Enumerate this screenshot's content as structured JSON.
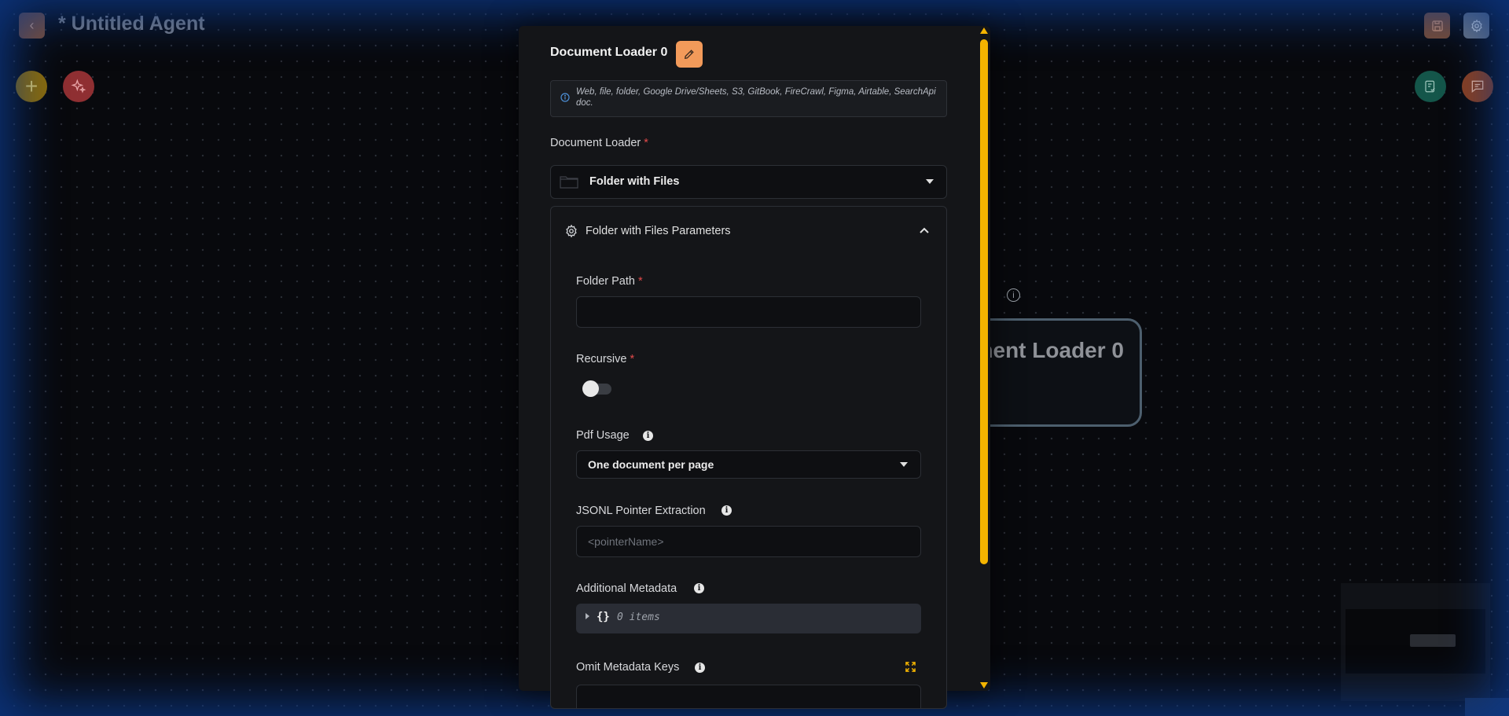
{
  "app": {
    "title": "* Untitled Agent",
    "accent": "#f29a5a"
  },
  "canvas_node": {
    "title": "ment Loader 0"
  },
  "panel": {
    "title": "Document Loader 0",
    "description": "Web, file, folder, Google Drive/Sheets, S3, GitBook, FireCrawl, Figma, Airtable, SearchApi doc.",
    "document_loader": {
      "label": "Document Loader",
      "required": "*",
      "selected": "Folder with Files"
    },
    "params": {
      "title": "Folder with Files Parameters",
      "folder_path": {
        "label": "Folder Path",
        "required": "*",
        "value": ""
      },
      "recursive": {
        "label": "Recursive",
        "required": "*",
        "on": false
      },
      "pdf_usage": {
        "label": "Pdf Usage",
        "selected": "One document per page"
      },
      "jsonl_pointer": {
        "label": "JSONL Pointer Extraction",
        "placeholder": "<pointerName>"
      },
      "additional_metadata": {
        "label": "Additional Metadata",
        "braces": "{}",
        "count": "0 items"
      },
      "omit_metadata_keys": {
        "label": "Omit Metadata Keys"
      }
    }
  },
  "scrollbar": {
    "color": "#f4b400"
  }
}
